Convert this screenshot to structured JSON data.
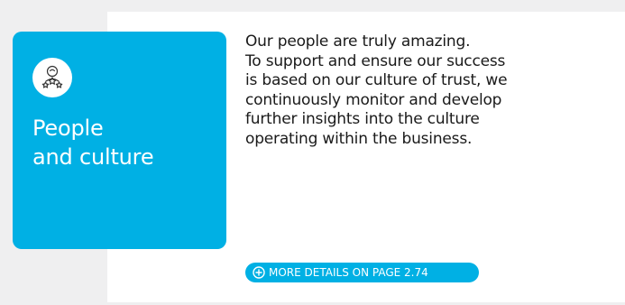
{
  "card": {
    "icon": "person-stars-icon",
    "title_lines": [
      "People",
      "and culture"
    ]
  },
  "body": {
    "lines": [
      "Our people are truly amazing.",
      "To support and ensure our success",
      "is based on our culture of trust, we",
      "continuously monitor and develop",
      "further insights into the culture",
      "operating within the business."
    ]
  },
  "link": {
    "icon": "plus-circle-icon",
    "label": "MORE DETAILS ON PAGE 2.74"
  },
  "colors": {
    "accent": "#00b0e4",
    "page_background": "#efeff0",
    "panel_background": "#ffffff",
    "text": "#1a1a1a"
  }
}
